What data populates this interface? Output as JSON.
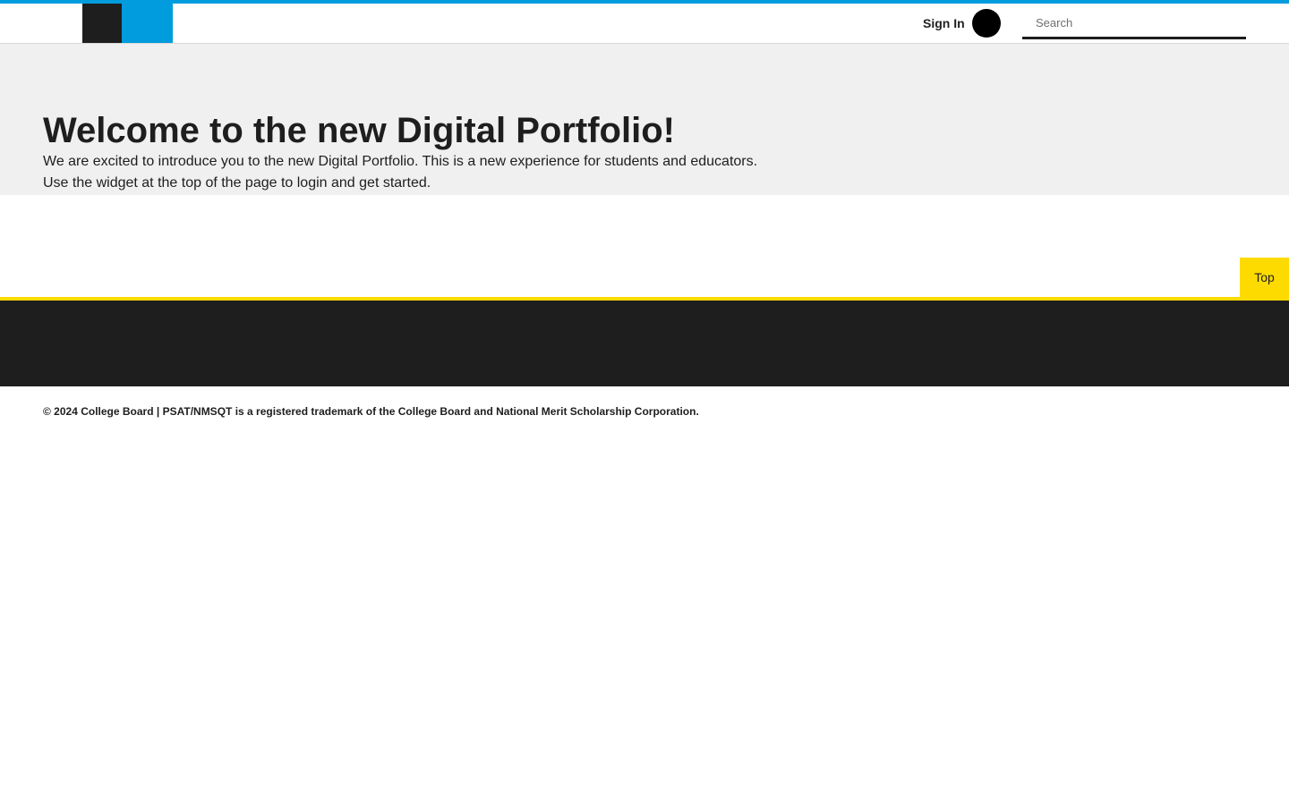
{
  "header": {
    "signin_label": "Sign In",
    "search_placeholder": "Search",
    "search_value": "",
    "logo_icon": "college-board-logo-icon",
    "user_icon": "user-avatar-icon"
  },
  "hero": {
    "title": "Welcome to the new Digital Portfolio!",
    "text_line1": "We are excited to introduce you to the new Digital Portfolio. This is a new experience for students and educators.",
    "text_line2": "Use the widget at the top of the page to login and get started."
  },
  "back_to_top": {
    "label": "Top"
  },
  "footer": {
    "copyright": "© 2024 College Board | PSAT/NMSQT is a registered trademark of the College Board and National Merit Scholarship Corporation."
  },
  "colors": {
    "brand_blue": "#009cde",
    "brand_yellow": "#fedb00",
    "dark": "#1e1e1e",
    "hero_background": "#f0f0f0"
  }
}
